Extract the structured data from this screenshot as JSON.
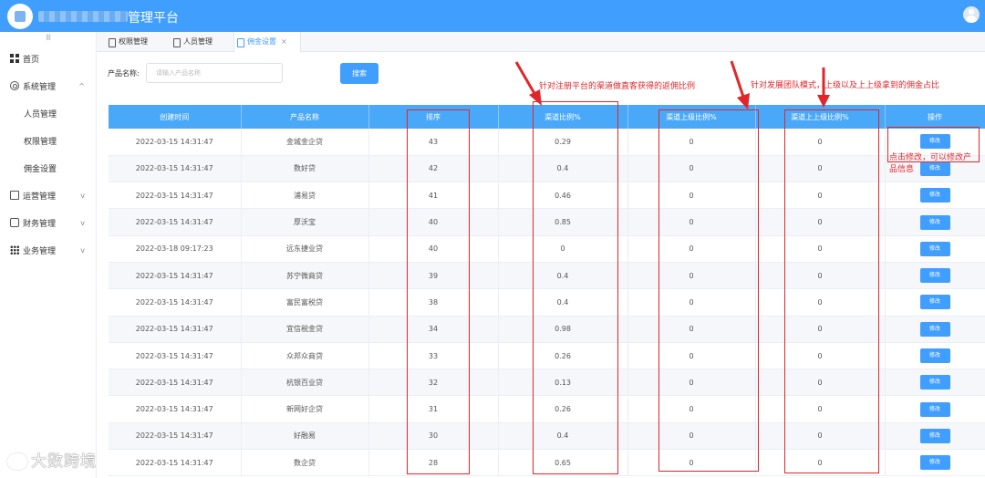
{
  "app": {
    "title": "管理平台"
  },
  "sidebar": {
    "collapse_label": "III",
    "items": [
      {
        "label": "首页",
        "icon": "grid-icon"
      },
      {
        "label": "系统管理",
        "icon": "gear-icon",
        "chevron": "^"
      },
      {
        "label": "人员管理",
        "sub": true
      },
      {
        "label": "权限管理",
        "sub": true
      },
      {
        "label": "佣金设置",
        "sub": true
      },
      {
        "label": "运营管理",
        "icon": "document-icon",
        "chevron": "v"
      },
      {
        "label": "财务管理",
        "icon": "money-icon",
        "chevron": "v"
      },
      {
        "label": "业务管理",
        "icon": "apps-icon",
        "chevron": "v"
      }
    ]
  },
  "tabs": [
    {
      "label": "权限管理"
    },
    {
      "label": "人员管理"
    },
    {
      "label": "佣金设置",
      "close": "×"
    }
  ],
  "search": {
    "label": "产品名称:",
    "placeholder": "请输入产品名称",
    "button": "搜索"
  },
  "table": {
    "headers": [
      "创建时间",
      "产品名称",
      "排序",
      "渠道比例%",
      "渠道上级比例%",
      "渠道上上级比例%",
      "操作"
    ],
    "edit_label": "修改",
    "rows": [
      [
        "2022-03-15 14:31:47",
        "金城金企贷",
        "43",
        "0.29",
        "0",
        "0"
      ],
      [
        "2022-03-15 14:31:47",
        "数好贷",
        "42",
        "0.4",
        "0",
        "0"
      ],
      [
        "2022-03-15 14:31:47",
        "浦易贷",
        "41",
        "0.46",
        "0",
        "0"
      ],
      [
        "2022-03-15 14:31:47",
        "厚沃宝",
        "40",
        "0.85",
        "0",
        "0"
      ],
      [
        "2022-03-18 09:17:23",
        "远东捷业贷",
        "40",
        "0",
        "0",
        "0"
      ],
      [
        "2022-03-15 14:31:47",
        "苏宁微商贷",
        "39",
        "0.4",
        "0",
        "0"
      ],
      [
        "2022-03-15 14:31:47",
        "富民富税贷",
        "38",
        "0.4",
        "0",
        "0"
      ],
      [
        "2022-03-15 14:31:47",
        "宜信税金贷",
        "34",
        "0.98",
        "0",
        "0"
      ],
      [
        "2022-03-15 14:31:47",
        "众邦众商贷",
        "33",
        "0.26",
        "0",
        "0"
      ],
      [
        "2022-03-15 14:31:47",
        "杭银百业贷",
        "32",
        "0.13",
        "0",
        "0"
      ],
      [
        "2022-03-15 14:31:47",
        "新网好企贷",
        "31",
        "0.26",
        "0",
        "0"
      ],
      [
        "2022-03-15 14:31:47",
        "好融易",
        "30",
        "0.4",
        "0",
        "0"
      ],
      [
        "2022-03-15 14:31:47",
        "数企贷",
        "28",
        "0.65",
        "0",
        "0"
      ]
    ]
  },
  "annotations": {
    "channel_ratio": "针对注册平台的渠道做直客获得的返佣比例",
    "team_ratio": "针对发展团队模式，上级以及上上级拿到的佣金占比",
    "edit_hint_line1": "点击修改，可以修改产",
    "edit_hint_line2": "品信息",
    "color": "#e0262b"
  },
  "watermark": "大数跨境"
}
